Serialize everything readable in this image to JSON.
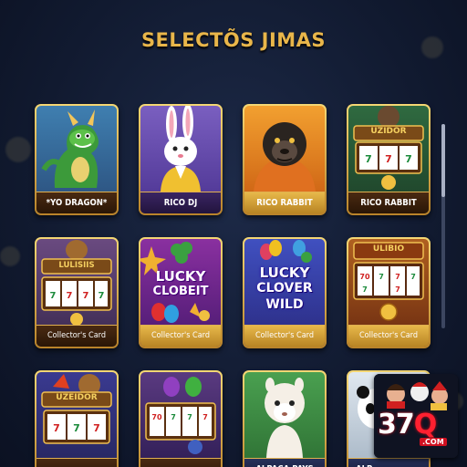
{
  "page": {
    "title": "SELECTÕS JIMAS"
  },
  "games": [
    {
      "label": "*YO DRAGON*",
      "art_text": ""
    },
    {
      "label": "RICO DJ",
      "art_text": ""
    },
    {
      "label": "RICO RABBIT",
      "art_text": ""
    },
    {
      "label": "RICO RABBIT",
      "art_text": "UZIDOR"
    },
    {
      "label": "Collector's Card",
      "art_text": "LULISIIS"
    },
    {
      "label": "Collector's Card",
      "art_text_1": "LUCKY",
      "art_text_2": "CLOBEIT"
    },
    {
      "label": "Collector's Card",
      "art_text_1": "LUCKY",
      "art_text_2": "CLOVER",
      "art_text_3": "WILD"
    },
    {
      "label": "Collector's Card",
      "art_text": "ULIBIO"
    },
    {
      "label": "",
      "art_text": "UZEIDOR"
    },
    {
      "label": "",
      "art_text": ""
    },
    {
      "label": "ALPACA PAYS",
      "art_text": ""
    },
    {
      "label": "ALP",
      "art_text": ""
    }
  ],
  "reels": {
    "symbol_a": "7",
    "symbol_b": "70"
  },
  "logo": {
    "number": "37",
    "accent": "Q",
    "suffix": ".COM"
  },
  "colors": {
    "title": "#e9b64a",
    "background": "#111a30",
    "card_border": "#d9a84a"
  }
}
